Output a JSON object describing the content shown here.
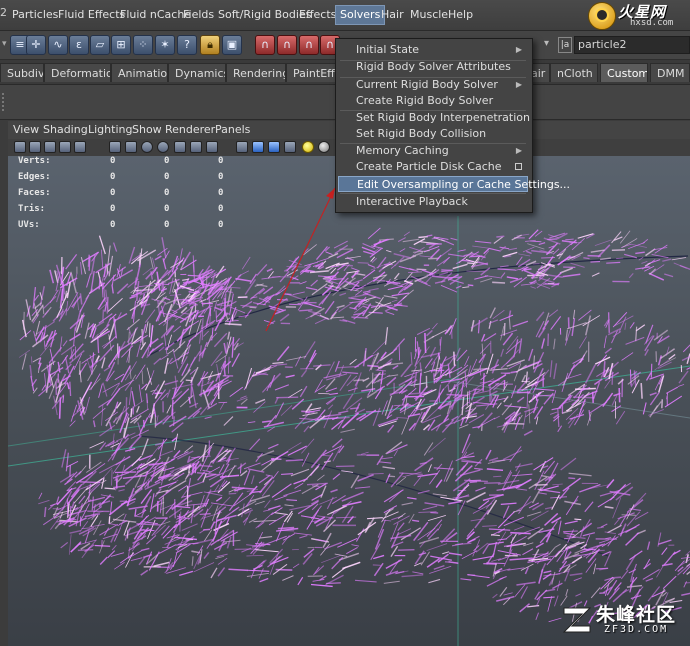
{
  "window": {
    "number_fragment": "2"
  },
  "menubar": {
    "items": [
      "Particles",
      "Fluid Effects",
      "Fluid nCache",
      "Fields",
      "Soft/Rigid Bodies",
      "Effects",
      "Solvers",
      "Hair",
      "Muscle",
      "Help"
    ],
    "active_item": "Solvers"
  },
  "logo": {
    "title": "火星网",
    "subtitle": "hxsd.com"
  },
  "toolbar": {
    "selection_field_value": "particle2"
  },
  "shelf_tabs": {
    "items": [
      "Subdivs",
      "Deformation",
      "Animation",
      "Dynamics",
      "Rendering",
      "PaintEffe",
      "air",
      "nCloth",
      "Custom",
      "DMM"
    ],
    "active": "Custom"
  },
  "viewport_menu": {
    "items": [
      "View",
      "Shading",
      "Lighting",
      "Show",
      "Renderer",
      "Panels"
    ]
  },
  "hud": {
    "rows": [
      {
        "label": "Verts:",
        "values": [
          "0",
          "0",
          "0"
        ]
      },
      {
        "label": "Edges:",
        "values": [
          "0",
          "0",
          "0"
        ]
      },
      {
        "label": "Faces:",
        "values": [
          "0",
          "0",
          "0"
        ]
      },
      {
        "label": "Tris:",
        "values": [
          "0",
          "0",
          "0"
        ]
      },
      {
        "label": "UVs:",
        "values": [
          "0",
          "0",
          "0"
        ]
      }
    ]
  },
  "solvers_menu": {
    "items": [
      {
        "label": "Initial State",
        "submenu": true
      },
      {
        "label": "Rigid Body Solver Attributes"
      },
      {
        "label": "Current Rigid Body Solver",
        "submenu": true
      },
      {
        "label": "Create Rigid Body Solver"
      },
      {
        "label": "Set Rigid Body Interpenetration"
      },
      {
        "label": "Set Rigid Body Collision"
      },
      {
        "label": "Memory Caching",
        "submenu": true
      },
      {
        "label": "Create Particle Disk Cache",
        "option_box": true
      },
      {
        "label": "Edit Oversampling or Cache Settings...",
        "highlighted": true
      },
      {
        "label": "Interactive Playback"
      }
    ]
  },
  "watermark": {
    "title": "朱峰社区",
    "subtitle": "ZF3D.COM"
  },
  "colors": {
    "menu_highlight": "#5a7698",
    "particles": "#e07cff",
    "particles_core": "#ffd6ff",
    "annotation_arrow": "#c82020",
    "grid_line": "#3fb89a"
  }
}
